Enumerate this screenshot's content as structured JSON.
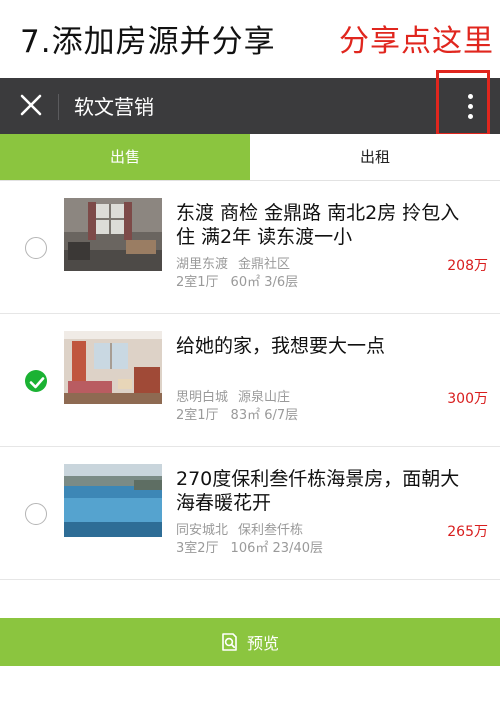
{
  "caption": {
    "step_title": "7.添加房源并分享",
    "hint": "分享点这里"
  },
  "appbar": {
    "title": "软文营销"
  },
  "tabs": [
    {
      "label": "出售",
      "active": true
    },
    {
      "label": "出租",
      "active": false
    }
  ],
  "listings": [
    {
      "title": "东渡 商检 金鼎路 南北2房 拎包入住 满2年 读东渡一小",
      "district": "湖里东渡",
      "community": "金鼎社区",
      "layout": "2室1厅",
      "area": "60㎡",
      "floor": "3/6层",
      "price": "208万",
      "selected": false
    },
    {
      "title": "给她的家，我想要大一点",
      "district": "思明白城",
      "community": "源泉山庄",
      "layout": "2室1厅",
      "area": "83㎡",
      "floor": "6/7层",
      "price": "300万",
      "selected": true
    },
    {
      "title": "270度保利叁仟栋海景房，面朝大海春暖花开",
      "district": "同安城北",
      "community": "保利叁仟栋",
      "layout": "3室2厅",
      "area": "106㎡",
      "floor": "23/40层",
      "price": "265万",
      "selected": false
    }
  ],
  "bottom_bar": {
    "preview_label": "预览",
    "icon": "search-document-icon"
  },
  "colors": {
    "brand_green": "#8bc53f",
    "appbar_bg": "#3b3b3d",
    "price_red": "#d81e1e",
    "hint_red": "#e0261e",
    "check_green": "#1bb233"
  }
}
